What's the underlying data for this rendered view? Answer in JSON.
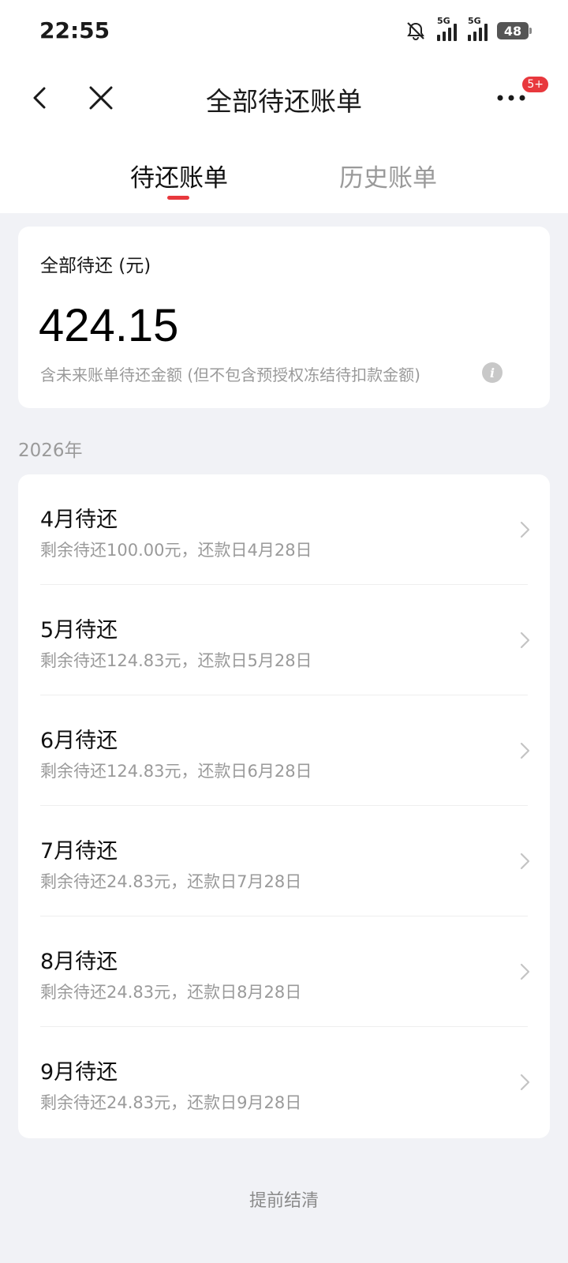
{
  "status_bar": {
    "time": "22:55",
    "net1": "5G",
    "net2": "5G",
    "battery": "48"
  },
  "nav": {
    "title": "全部待还账单",
    "badge": "5+"
  },
  "tabs": {
    "active": "待还账单",
    "history": "历史账单"
  },
  "summary": {
    "label": "全部待还 (元)",
    "amount": "424.15",
    "note": "含未来账单待还金额 (但不包含预授权冻结待扣款金额)"
  },
  "year": "2026年",
  "bills": [
    {
      "title": "4月待还",
      "subtitle": "剩余待还100.00元，还款日4月28日"
    },
    {
      "title": "5月待还",
      "subtitle": "剩余待还124.83元，还款日5月28日"
    },
    {
      "title": "6月待还",
      "subtitle": "剩余待还124.83元，还款日6月28日"
    },
    {
      "title": "7月待还",
      "subtitle": "剩余待还24.83元，还款日7月28日"
    },
    {
      "title": "8月待还",
      "subtitle": "剩余待还24.83元，还款日8月28日"
    },
    {
      "title": "9月待还",
      "subtitle": "剩余待还24.83元，还款日9月28日"
    }
  ],
  "footer": {
    "settle_label": "提前结清"
  },
  "colors": {
    "accent": "#e8383d",
    "background": "#f1f2f6",
    "secondary_text": "#9a9a9a"
  }
}
